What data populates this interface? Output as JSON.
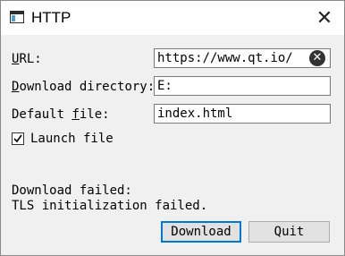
{
  "window": {
    "title": "HTTP"
  },
  "form": {
    "url": {
      "label_first": "U",
      "label_rest": "RL:",
      "value": "https://www.qt.io/"
    },
    "download_directory": {
      "label_first": "D",
      "label_rest": "ownload directory:",
      "value": "E:"
    },
    "default_file": {
      "label_pre": "Default ",
      "label_underlined": "f",
      "label_post": "ile:",
      "value": "index.html"
    },
    "launch_file": {
      "label": "Launch file",
      "checked": true
    }
  },
  "status": {
    "line1": "Download failed:",
    "line2": "TLS initialization failed."
  },
  "buttons": {
    "download": "Download",
    "quit": "Quit"
  }
}
